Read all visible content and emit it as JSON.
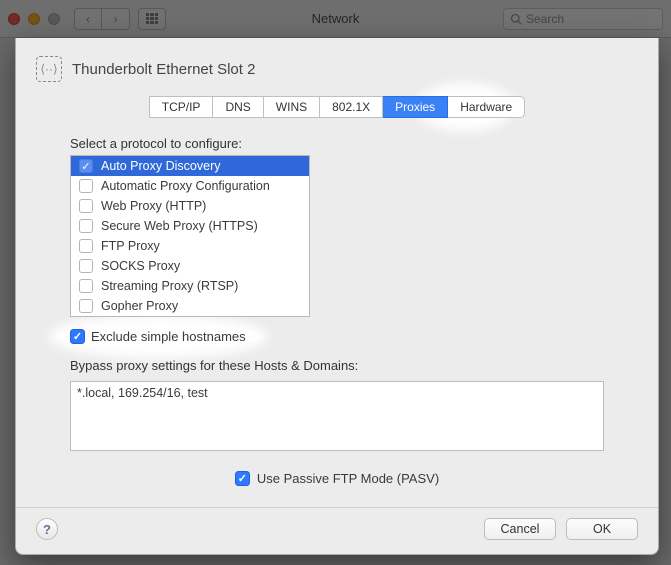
{
  "window": {
    "title": "Network",
    "search_placeholder": "Search"
  },
  "sheet": {
    "title": "Thunderbolt Ethernet Slot 2"
  },
  "tabs": [
    "TCP/IP",
    "DNS",
    "WINS",
    "802.1X",
    "Proxies",
    "Hardware"
  ],
  "selected_tab_index": 4,
  "protocols": {
    "label": "Select a protocol to configure:",
    "items": [
      {
        "label": "Auto Proxy Discovery",
        "checked": true,
        "selected": true
      },
      {
        "label": "Automatic Proxy Configuration",
        "checked": false,
        "selected": false
      },
      {
        "label": "Web Proxy (HTTP)",
        "checked": false,
        "selected": false
      },
      {
        "label": "Secure Web Proxy (HTTPS)",
        "checked": false,
        "selected": false
      },
      {
        "label": "FTP Proxy",
        "checked": false,
        "selected": false
      },
      {
        "label": "SOCKS Proxy",
        "checked": false,
        "selected": false
      },
      {
        "label": "Streaming Proxy (RTSP)",
        "checked": false,
        "selected": false
      },
      {
        "label": "Gopher Proxy",
        "checked": false,
        "selected": false
      }
    ]
  },
  "exclude": {
    "label": "Exclude simple hostnames",
    "checked": true
  },
  "bypass": {
    "label": "Bypass proxy settings for these Hosts & Domains:",
    "value": "*.local, 169.254/16, test"
  },
  "pasv": {
    "label": "Use Passive FTP Mode (PASV)",
    "checked": true
  },
  "buttons": {
    "cancel": "Cancel",
    "ok": "OK",
    "help": "?"
  },
  "colors": {
    "accent": "#2f78ff",
    "selection": "#2f68d8"
  }
}
